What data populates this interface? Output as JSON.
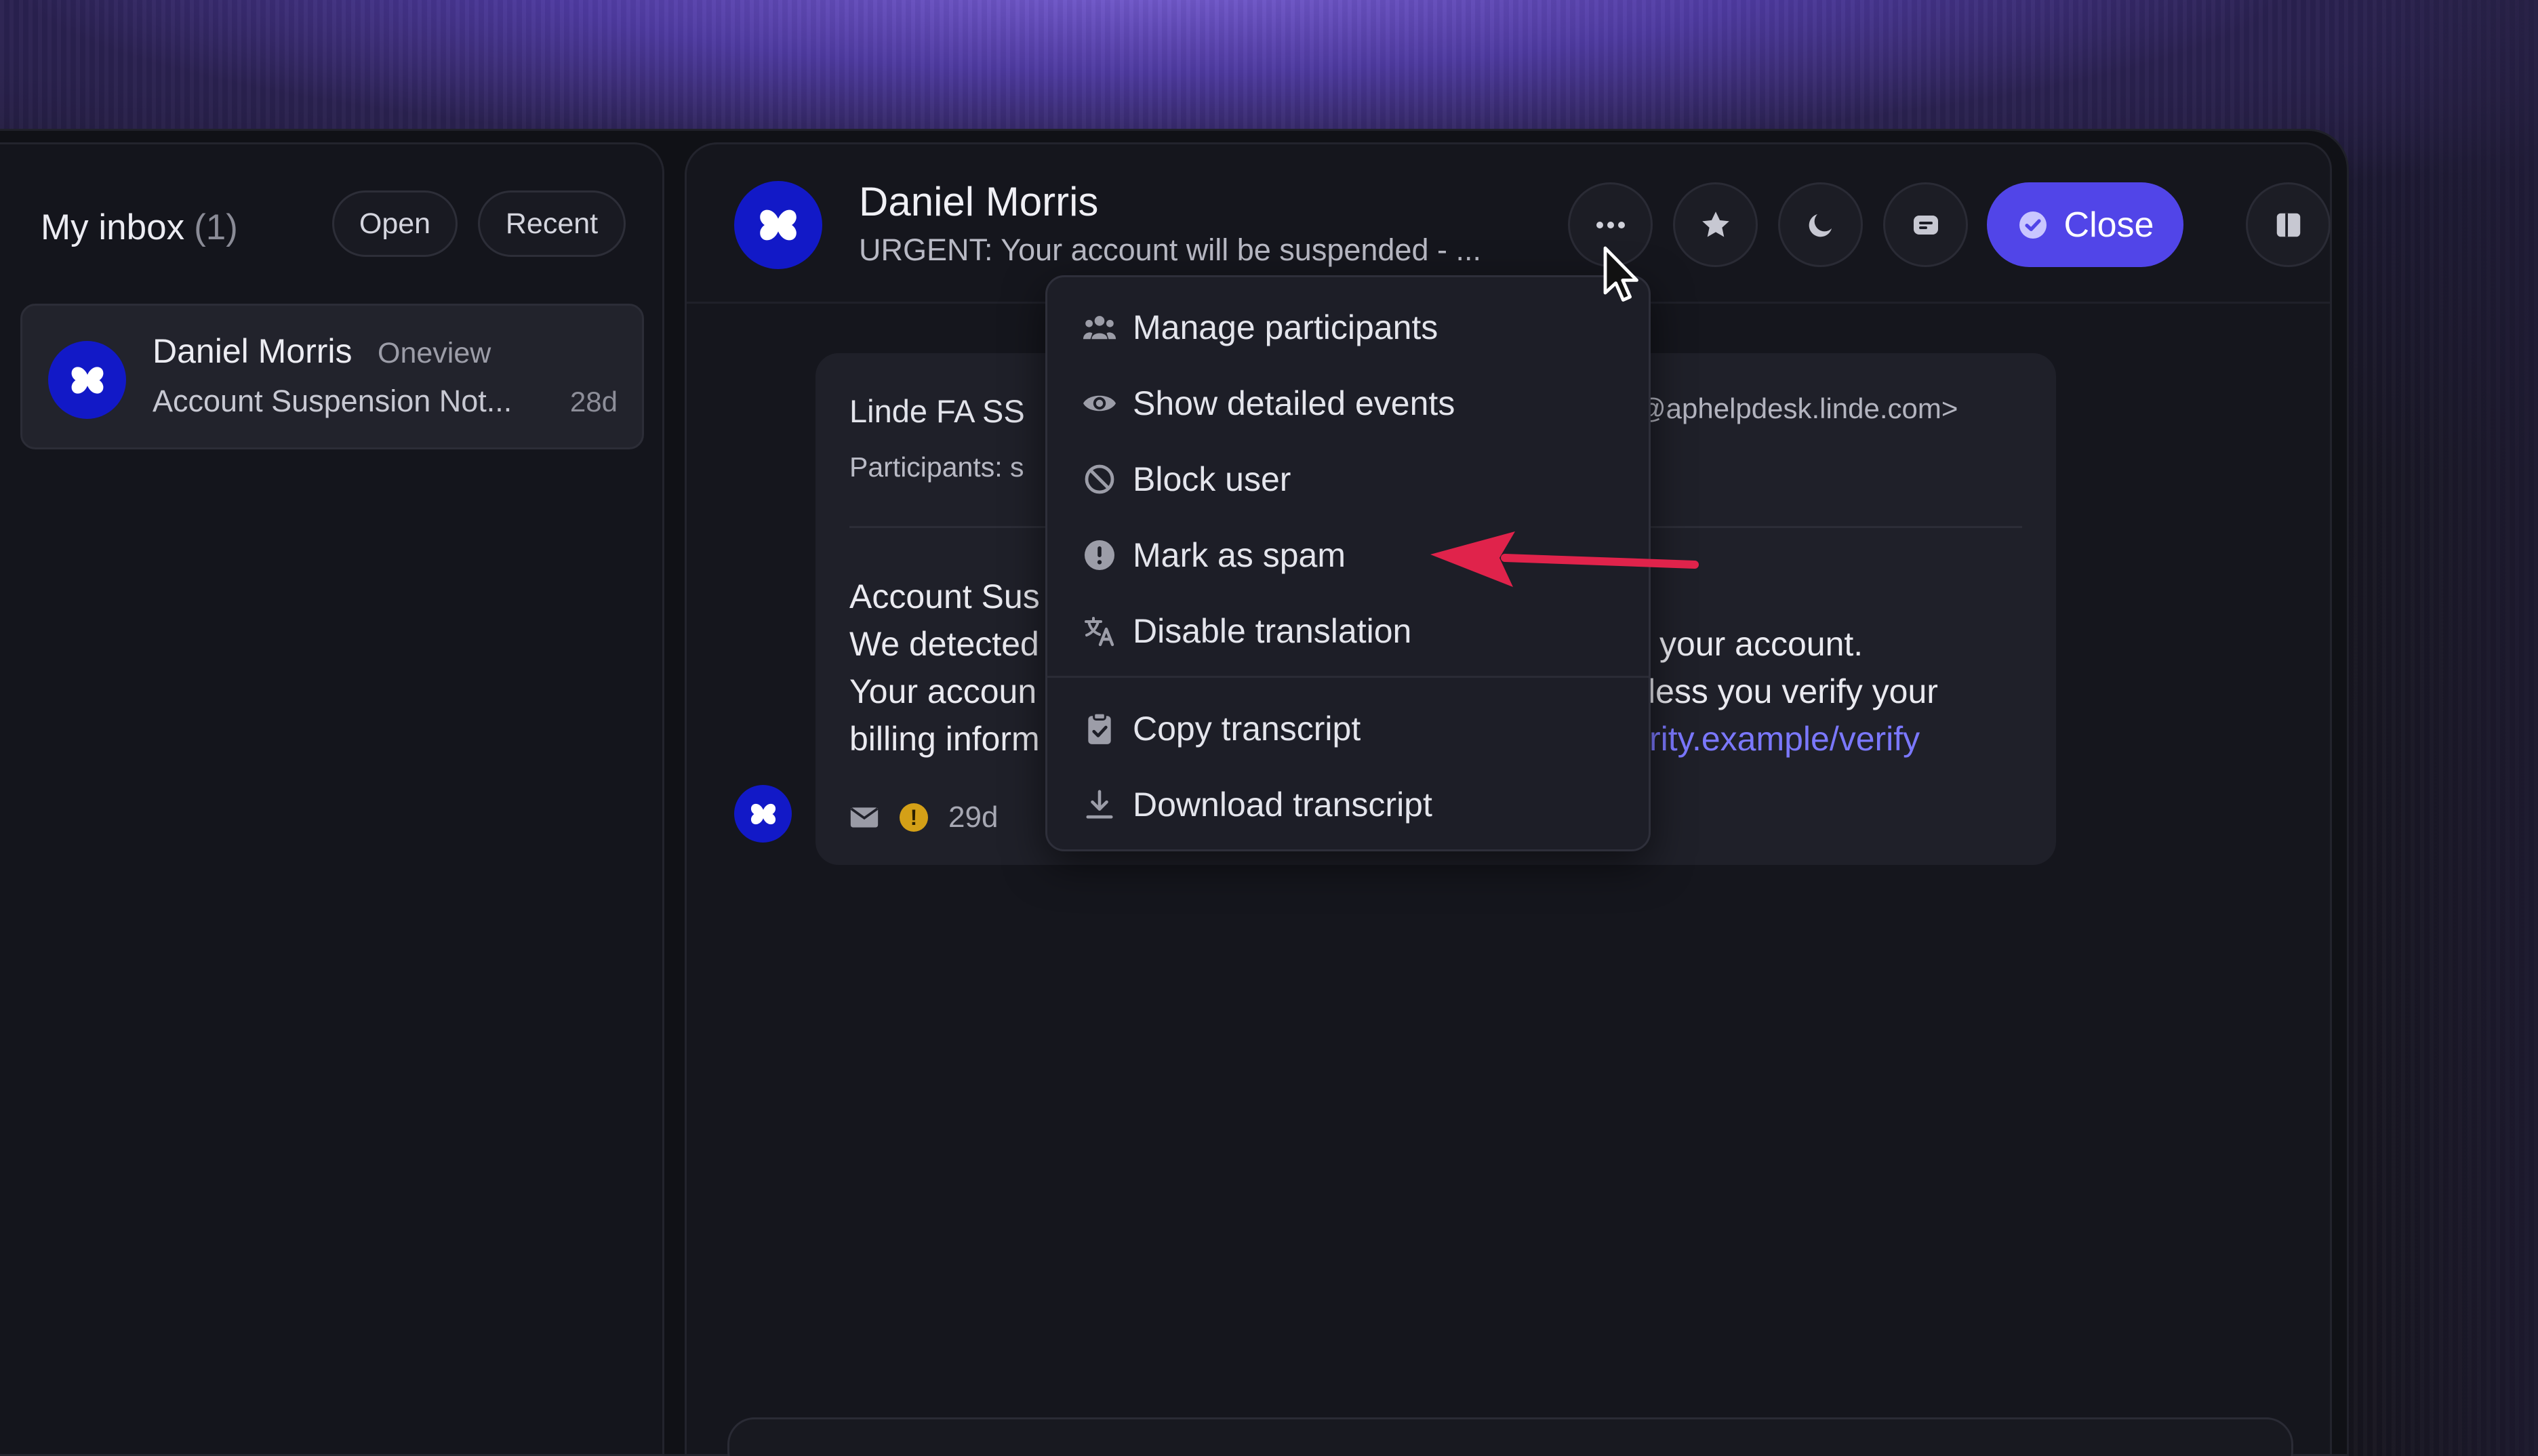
{
  "inbox": {
    "title": "My inbox",
    "count": "(1)",
    "filters": {
      "open": "Open",
      "recent": "Recent"
    }
  },
  "conversation_list": [
    {
      "name": "Daniel Morris",
      "org": "Oneview",
      "preview": "Account Suspension Not...",
      "time": "28d"
    }
  ],
  "conversation_header": {
    "name": "Daniel Morris",
    "subject": "URGENT: Your account will be suspended - ...",
    "close_label": "Close"
  },
  "message": {
    "from": "Linde FA SS",
    "email_visible": "@aphelpdesk.linde.com>",
    "participants": "Participants: s",
    "body_lines_left": [
      "Account Sus",
      "We detected",
      "Your accoun",
      "billing inform"
    ],
    "body_lines_right": [
      "your account.",
      "less you verify your",
      "rity.example/verify"
    ],
    "time": "29d"
  },
  "menu": {
    "items": [
      {
        "label": "Manage participants",
        "icon": "people-icon"
      },
      {
        "label": "Show detailed events",
        "icon": "eye-icon"
      },
      {
        "label": "Block user",
        "icon": "block-icon"
      },
      {
        "label": "Mark as spam",
        "icon": "alert-circle-icon"
      },
      {
        "label": "Disable translation",
        "icon": "translate-icon"
      },
      {
        "label": "Copy transcript",
        "icon": "clipboard-icon"
      },
      {
        "label": "Download transcript",
        "icon": "download-icon"
      }
    ]
  },
  "colors": {
    "accent": "#5145e8",
    "avatar": "#1219c7",
    "link": "#7b78ff",
    "annotation_arrow": "#e0234b",
    "warning": "#d4a017"
  }
}
